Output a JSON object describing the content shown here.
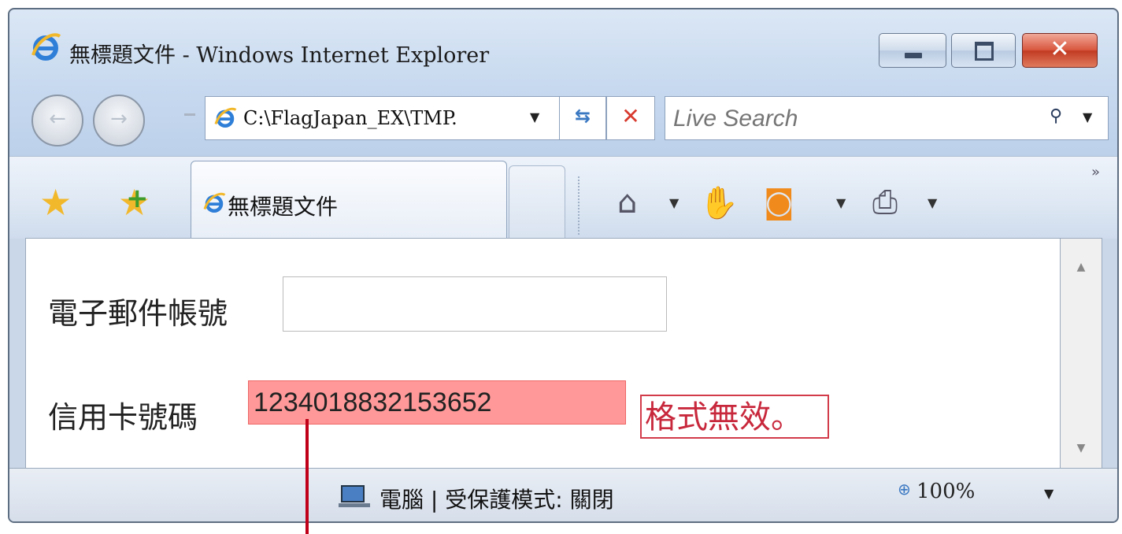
{
  "window": {
    "title": "無標題文件 - Windows Internet Explorer",
    "close_glyph": "✕"
  },
  "nav": {
    "address": "C:\\FlagJapan_EX\\TMP.",
    "search_placeholder": "Live Search"
  },
  "tab": {
    "label": "無標題文件"
  },
  "form": {
    "email_label": "電子郵件帳號",
    "email_value": "",
    "card_label": "信用卡號碼",
    "card_value": "1234018832153652",
    "error_message": "格式無效。"
  },
  "status": {
    "zone": "電腦 | 受保護模式: 關閉",
    "zoom": "100%"
  },
  "colors": {
    "invalid_fill": "#ff9999",
    "error_text": "#c8283c",
    "close_red": "#c13a22"
  }
}
